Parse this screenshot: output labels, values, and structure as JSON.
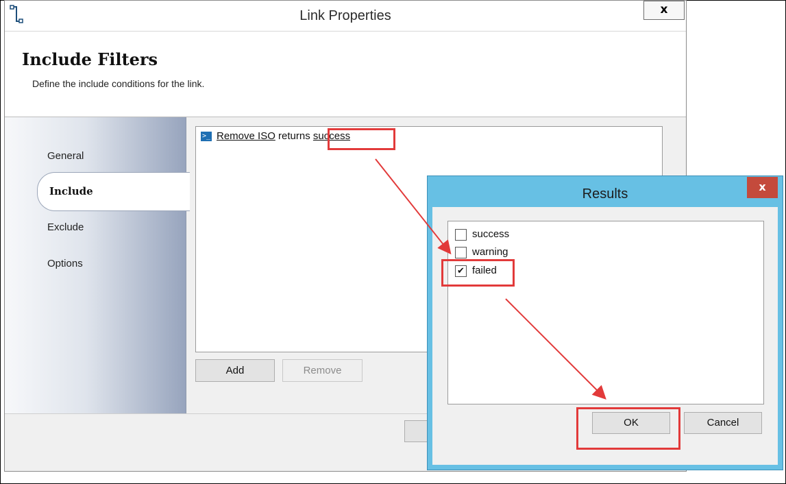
{
  "window": {
    "title": "Link Properties",
    "close_label": "x",
    "header_title": "Include Filters",
    "header_subtitle": "Define the include conditions for the link."
  },
  "sidebar": {
    "items": [
      {
        "label": "General"
      },
      {
        "label": "Include"
      },
      {
        "label": "Exclude"
      },
      {
        "label": "Options"
      }
    ]
  },
  "condition": {
    "icon": "powershell-icon",
    "icon_glyph": ">_",
    "activity": "Remove ISO",
    "connector": "returns",
    "result": "success"
  },
  "buttons": {
    "add": "Add",
    "remove": "Remove"
  },
  "results_dialog": {
    "title": "Results",
    "close_label": "x",
    "options": [
      {
        "label": "success",
        "checked": false
      },
      {
        "label": "warning",
        "checked": false
      },
      {
        "label": "failed",
        "checked": true
      }
    ],
    "ok": "OK",
    "cancel": "Cancel"
  },
  "colors": {
    "annotation": "#e23a3a",
    "dialog_frame": "#67c0e4",
    "close_button": "#c44a3c"
  }
}
